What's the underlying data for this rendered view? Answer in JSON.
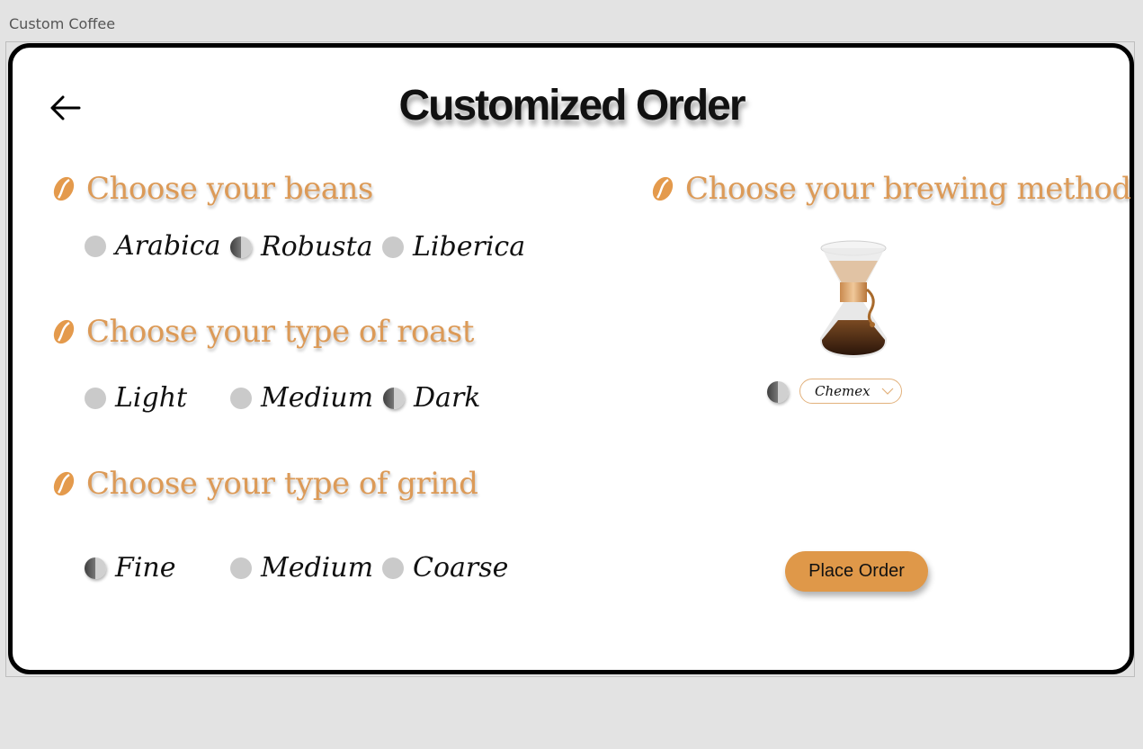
{
  "window": {
    "title": "Custom Coffee"
  },
  "page": {
    "title": "Customized Order"
  },
  "beans": {
    "heading": "Choose your beans",
    "options": [
      "Arabica",
      "Robusta",
      "Liberica"
    ],
    "selected": "Robusta"
  },
  "roast": {
    "heading": "Choose your type of roast",
    "options": [
      "Light",
      "Medium",
      "Dark"
    ],
    "selected": "Dark"
  },
  "grind": {
    "heading": "Choose your type of grind",
    "options": [
      "Fine",
      "Medium",
      "Coarse"
    ],
    "selected": "Fine"
  },
  "brewing": {
    "heading": "Choose your brewing method",
    "selected_method": "Chemex",
    "image_icon": "chemex-coffee-maker"
  },
  "actions": {
    "place_order": "Place Order"
  },
  "colors": {
    "accent": "#df9849",
    "heading": "#dc9a57",
    "radio_unselected": "#cacaca"
  }
}
